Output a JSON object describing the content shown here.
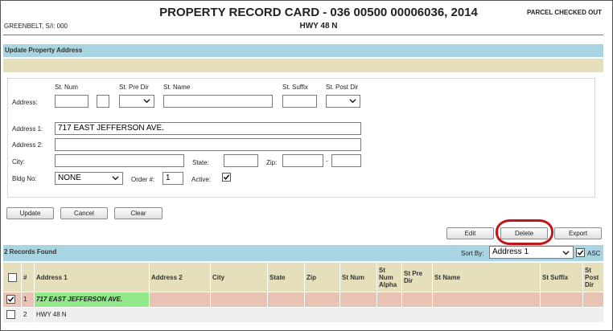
{
  "header": {
    "title": "PROPERTY RECORD CARD - 036 00500 00006036, 2014",
    "subtitle": "HWY 48 N",
    "left": "GREENBELT, S/I: 000",
    "status": "PARCEL CHECKED OUT"
  },
  "section_title": "Update Property Address",
  "form": {
    "address_label": "Address:",
    "st_num_label": "St. Num",
    "st_pre_dir_label": "St. Pre Dir",
    "st_name_label": "St. Name",
    "st_suffix_label": "St. Suffix",
    "st_post_dir_label": "St. Post Dir",
    "address1_label": "Address 1:",
    "address1_value": "717 EAST JEFFERSON AVE.",
    "address2_label": "Address 2:",
    "address2_value": "",
    "city_label": "City:",
    "state_label": "State:",
    "zip_label": "Zip:",
    "zip_sep": "-",
    "bldg_label": "Bldg No:",
    "bldg_value": "NONE",
    "order_label": "Order #:",
    "order_value": "1",
    "active_label": "Active:",
    "active_checked": true
  },
  "buttons": {
    "update": "Update",
    "cancel": "Cancel",
    "clear": "Clear",
    "edit": "Edit",
    "delete": "Delete",
    "export": "Export"
  },
  "records": {
    "found_label": "2 Records Found",
    "sort_label": "Sort By:",
    "sort_value": "Address 1",
    "asc_label": "ASC",
    "columns": [
      "#",
      "Address 1",
      "Address 2",
      "City",
      "State",
      "Zip",
      "St Num",
      "St Num Alpha",
      "St Pre Dir",
      "St Name",
      "St Suffix",
      "St Post Dir"
    ],
    "rows": [
      {
        "num": "1",
        "address1": "717 EAST JEFFERSON AVE.",
        "checked": true,
        "selected": true
      },
      {
        "num": "2",
        "address1": "HWY 48 N",
        "checked": false,
        "selected": false
      }
    ]
  },
  "colors": {
    "section_bar": "#a9d5e3",
    "tan_bar": "#e6dfbc",
    "selected_row": "#e8c3b4",
    "selected_cell": "#92e88a",
    "highlight_ring": "#c0141a"
  }
}
